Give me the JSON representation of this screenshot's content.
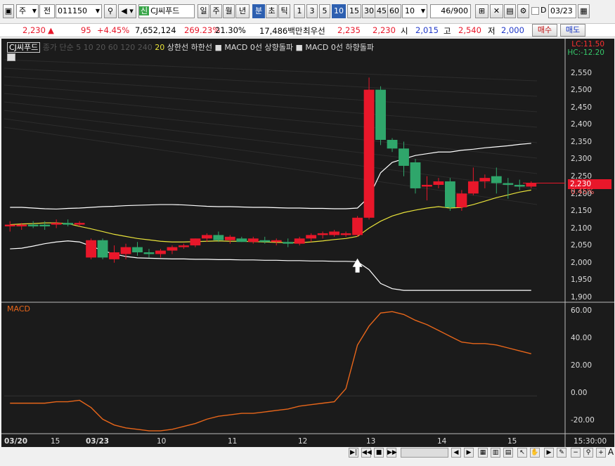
{
  "toolbar": {
    "market_type": "주",
    "mode": "전",
    "stock_code": "011150",
    "stock_badge": "신",
    "stock_name": "CJ씨푸드",
    "period_buttons": [
      "일",
      "주",
      "월",
      "년"
    ],
    "interval_unit_active": "분",
    "interval_units": [
      "초",
      "틱"
    ],
    "minute_buttons": [
      "1",
      "3",
      "5",
      "10",
      "15",
      "30",
      "45",
      "60"
    ],
    "active_minute": "10",
    "count_select": "10",
    "page_count": "46/900",
    "date_checkbox_label": "D",
    "date_value": "03/23"
  },
  "quote": {
    "price": "2,230",
    "change_arrow": "▲",
    "change": "95",
    "change_pct": "+4.45%",
    "volume": "7,652,124",
    "volume_ratio": "269.23%",
    "turnover": "21.30%",
    "amount": "17,486백만",
    "best_ask_label": "최우선",
    "best_ask": "2,235",
    "best_bid": "2,230",
    "open_label": "시",
    "open": "2,015",
    "high_label": "고",
    "high": "2,540",
    "low_label": "저",
    "low": "2,000",
    "buy_label": "매수",
    "sell_label": "매도"
  },
  "legend": {
    "stock_tag": "CJ씨푸드",
    "faint_text": "종가 단순 5 10 20 60 120 240",
    "ma_label": "20",
    "upper_band": "상한선",
    "lower_band": "하한선",
    "macd_up": "MACD 0선 상향돌파",
    "macd_down": "MACD 0선 하향돌파",
    "lc": "LC:11.50",
    "hc": "HC:-12.20"
  },
  "price_axis": [
    "2,550",
    "2,500",
    "2,450",
    "2,400",
    "2,350",
    "2,300",
    "2,250",
    "2,200",
    "2,150",
    "2,100",
    "2,050",
    "2,000",
    "1,950",
    "1,900"
  ],
  "current_price_tag": "2,230",
  "current_pct": "0.45%",
  "macd_label": "MACD",
  "macd_axis": [
    "60.00",
    "40.00",
    "20.00",
    "0.00",
    "-20.00"
  ],
  "time_axis": [
    {
      "label": "03/20",
      "bold": true
    },
    {
      "label": "15",
      "bold": false
    },
    {
      "label": "03/23",
      "bold": true
    },
    {
      "label": "10",
      "bold": false
    },
    {
      "label": "11",
      "bold": false
    },
    {
      "label": "12",
      "bold": false
    },
    {
      "label": "13",
      "bold": false
    },
    {
      "label": "14",
      "bold": false
    },
    {
      "label": "15",
      "bold": false
    }
  ],
  "clock": "15:30:00",
  "colors": {
    "up": "#e8172a",
    "down": "#2fa66b",
    "ma": "#e8e23a",
    "band": "#ffffff",
    "macd": "#e8661a"
  },
  "chart_data": [
    {
      "type": "candlestick",
      "title": "CJ씨푸드",
      "ylim": [
        1900,
        2550
      ],
      "series": [
        {
          "name": "candles",
          "values": [
            {
              "o": 2105,
              "h": 2120,
              "l": 2090,
              "c": 2110
            },
            {
              "o": 2105,
              "h": 2115,
              "l": 2095,
              "c": 2110
            },
            {
              "o": 2110,
              "h": 2120,
              "l": 2100,
              "c": 2105
            },
            {
              "o": 2110,
              "h": 2120,
              "l": 2095,
              "c": 2105
            },
            {
              "o": 2110,
              "h": 2125,
              "l": 2100,
              "c": 2115
            },
            {
              "o": 2115,
              "h": 2125,
              "l": 2105,
              "c": 2110
            },
            {
              "o": 2110,
              "h": 2120,
              "l": 2105,
              "c": 2115
            },
            {
              "o": 2015,
              "h": 2070,
              "l": 2010,
              "c": 2065
            },
            {
              "o": 2065,
              "h": 2070,
              "l": 2010,
              "c": 2015
            },
            {
              "o": 2010,
              "h": 2050,
              "l": 2000,
              "c": 2030
            },
            {
              "o": 2025,
              "h": 2055,
              "l": 2010,
              "c": 2045
            },
            {
              "o": 2045,
              "h": 2060,
              "l": 2020,
              "c": 2030
            },
            {
              "o": 2030,
              "h": 2040,
              "l": 2015,
              "c": 2025
            },
            {
              "o": 2025,
              "h": 2040,
              "l": 2015,
              "c": 2035
            },
            {
              "o": 2035,
              "h": 2050,
              "l": 2025,
              "c": 2045
            },
            {
              "o": 2045,
              "h": 2055,
              "l": 2040,
              "c": 2050
            },
            {
              "o": 2050,
              "h": 2070,
              "l": 2045,
              "c": 2070
            },
            {
              "o": 2070,
              "h": 2085,
              "l": 2060,
              "c": 2080
            },
            {
              "o": 2080,
              "h": 2090,
              "l": 2060,
              "c": 2065
            },
            {
              "o": 2065,
              "h": 2080,
              "l": 2055,
              "c": 2075
            },
            {
              "o": 2070,
              "h": 2075,
              "l": 2060,
              "c": 2060
            },
            {
              "o": 2060,
              "h": 2075,
              "l": 2055,
              "c": 2070
            },
            {
              "o": 2065,
              "h": 2075,
              "l": 2055,
              "c": 2060
            },
            {
              "o": 2060,
              "h": 2070,
              "l": 2050,
              "c": 2065
            },
            {
              "o": 2060,
              "h": 2070,
              "l": 2045,
              "c": 2055
            },
            {
              "o": 2055,
              "h": 2075,
              "l": 2050,
              "c": 2070
            },
            {
              "o": 2070,
              "h": 2085,
              "l": 2060,
              "c": 2080
            },
            {
              "o": 2080,
              "h": 2090,
              "l": 2070,
              "c": 2085
            },
            {
              "o": 2080,
              "h": 2095,
              "l": 2075,
              "c": 2090
            },
            {
              "o": 2080,
              "h": 2090,
              "l": 2075,
              "c": 2085
            },
            {
              "o": 2080,
              "h": 2135,
              "l": 2075,
              "c": 2130
            },
            {
              "o": 2130,
              "h": 2535,
              "l": 2125,
              "c": 2500
            },
            {
              "o": 2500,
              "h": 2510,
              "l": 2340,
              "c": 2355
            },
            {
              "o": 2355,
              "h": 2360,
              "l": 2320,
              "c": 2330
            },
            {
              "o": 2330,
              "h": 2350,
              "l": 2250,
              "c": 2280
            },
            {
              "o": 2290,
              "h": 2300,
              "l": 2200,
              "c": 2215
            },
            {
              "o": 2220,
              "h": 2250,
              "l": 2180,
              "c": 2225
            },
            {
              "o": 2225,
              "h": 2245,
              "l": 2215,
              "c": 2235
            },
            {
              "o": 2235,
              "h": 2245,
              "l": 2150,
              "c": 2160
            },
            {
              "o": 2160,
              "h": 2210,
              "l": 2150,
              "c": 2200
            },
            {
              "o": 2200,
              "h": 2275,
              "l": 2195,
              "c": 2235
            },
            {
              "o": 2235,
              "h": 2255,
              "l": 2215,
              "c": 2245
            },
            {
              "o": 2250,
              "h": 2275,
              "l": 2200,
              "c": 2230
            },
            {
              "o": 2230,
              "h": 2245,
              "l": 2185,
              "c": 2225
            },
            {
              "o": 2225,
              "h": 2240,
              "l": 2210,
              "c": 2220
            },
            {
              "o": 2220,
              "h": 2235,
              "l": 2215,
              "c": 2230
            }
          ]
        },
        {
          "name": "20",
          "values": [
            2110,
            2112,
            2113,
            2115,
            2115,
            2113,
            2105,
            2098,
            2090,
            2082,
            2076,
            2070,
            2066,
            2062,
            2060,
            2060,
            2061,
            2062,
            2063,
            2062,
            2062,
            2061,
            2060,
            2059,
            2058,
            2058,
            2060,
            2063,
            2067,
            2070,
            2076,
            2100,
            2120,
            2135,
            2145,
            2152,
            2158,
            2162,
            2158,
            2160,
            2168,
            2178,
            2188,
            2196,
            2204,
            2210
          ]
        },
        {
          "name": "상한선",
          "values": [
            2160,
            2160,
            2158,
            2156,
            2155,
            2157,
            2158,
            2160,
            2162,
            2163,
            2165,
            2166,
            2167,
            2168,
            2168,
            2167,
            2165,
            2163,
            2162,
            2162,
            2161,
            2160,
            2160,
            2159,
            2158,
            2158,
            2157,
            2157,
            2156,
            2156,
            2158,
            2190,
            2260,
            2290,
            2300,
            2310,
            2315,
            2320,
            2320,
            2325,
            2328,
            2332,
            2335,
            2338,
            2342,
            2345
          ]
        },
        {
          "name": "하한선",
          "values": [
            2040,
            2042,
            2048,
            2055,
            2060,
            2063,
            2060,
            2048,
            2035,
            2025,
            2018,
            2014,
            2013,
            2012,
            2011,
            2011,
            2010,
            2010,
            2009,
            2009,
            2008,
            2008,
            2007,
            2007,
            2006,
            2006,
            2005,
            2005,
            2004,
            2004,
            2003,
            1980,
            1940,
            1925,
            1920,
            1920,
            1920,
            1920,
            1920,
            1920,
            1920,
            1920,
            1920,
            1920,
            1920,
            1920
          ]
        }
      ],
      "annotations": [
        "MACD 0선 상향돌파"
      ]
    },
    {
      "type": "line",
      "title": "MACD",
      "ylim": [
        -25,
        62
      ],
      "series": [
        {
          "name": "MACD",
          "values": [
            -5,
            -5,
            -5,
            -5,
            -4,
            -4,
            -3,
            -8,
            -16,
            -20,
            -22,
            -23,
            -24,
            -24,
            -23,
            -21,
            -19,
            -16,
            -14,
            -13,
            -12,
            -12,
            -11,
            -10,
            -9,
            -7,
            -6,
            -5,
            -4,
            5,
            35,
            48,
            57,
            58,
            56,
            52,
            49,
            45,
            41,
            37,
            36,
            36,
            35,
            33,
            31,
            29
          ]
        }
      ]
    }
  ]
}
